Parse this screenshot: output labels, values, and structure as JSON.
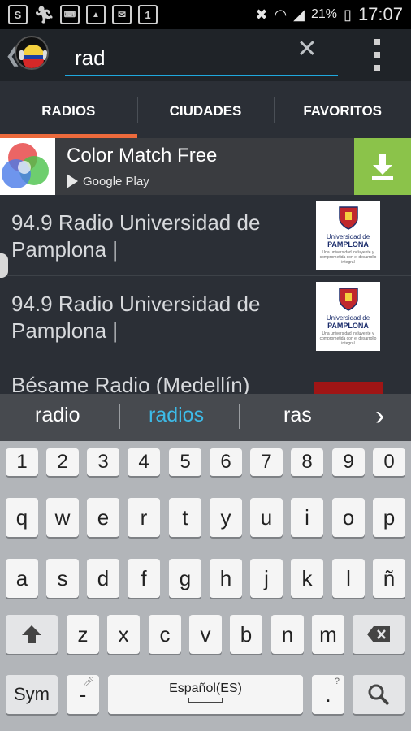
{
  "status_bar": {
    "battery": "21%",
    "time": "17:07",
    "left_icons": [
      "s-notification-icon",
      "runner-icon",
      "keyboard-icon",
      "image-icon",
      "mail-icon",
      "one-icon"
    ]
  },
  "search": {
    "query": "rad"
  },
  "tabs": [
    {
      "label": "RADIOS"
    },
    {
      "label": "CIUDADES"
    },
    {
      "label": "FAVORITOS"
    }
  ],
  "ad": {
    "title": "Color Match Free",
    "store": "Google Play"
  },
  "stations": [
    {
      "title": "94.9 Radio Universidad de Pamplona |",
      "thumb_line1": "Universidad de",
      "thumb_line2": "PAMPLONA",
      "thumb_line3": "Una universidad incluyente y comprometida con el desarrollo integral"
    },
    {
      "title": "94.9 Radio Universidad de Pamplona |",
      "thumb_line1": "Universidad de",
      "thumb_line2": "PAMPLONA",
      "thumb_line3": "Una universidad incluyente y comprometida con el desarrollo integral"
    },
    {
      "title": "Bésame Radio (Medellín)"
    }
  ],
  "suggestions": [
    "radio",
    "radios",
    "ras"
  ],
  "keyboard": {
    "numbers": [
      "1",
      "2",
      "3",
      "4",
      "5",
      "6",
      "7",
      "8",
      "9",
      "0"
    ],
    "row1": [
      "q",
      "w",
      "e",
      "r",
      "t",
      "y",
      "u",
      "i",
      "o",
      "p"
    ],
    "row2": [
      "a",
      "s",
      "d",
      "f",
      "g",
      "h",
      "j",
      "k",
      "l",
      "ñ"
    ],
    "row3": [
      "z",
      "x",
      "c",
      "v",
      "b",
      "n",
      "m"
    ],
    "sym": "Sym",
    "dash": "-",
    "space_label": "Español(ES)",
    "period": ".",
    "period_hint": "?",
    "dash_hint": "\""
  },
  "colors": {
    "accent_tab": "#ec6a3c",
    "search_underline": "#1fa8de",
    "suggestion_highlight": "#3dbbe8",
    "download_button": "#8bc34a"
  }
}
